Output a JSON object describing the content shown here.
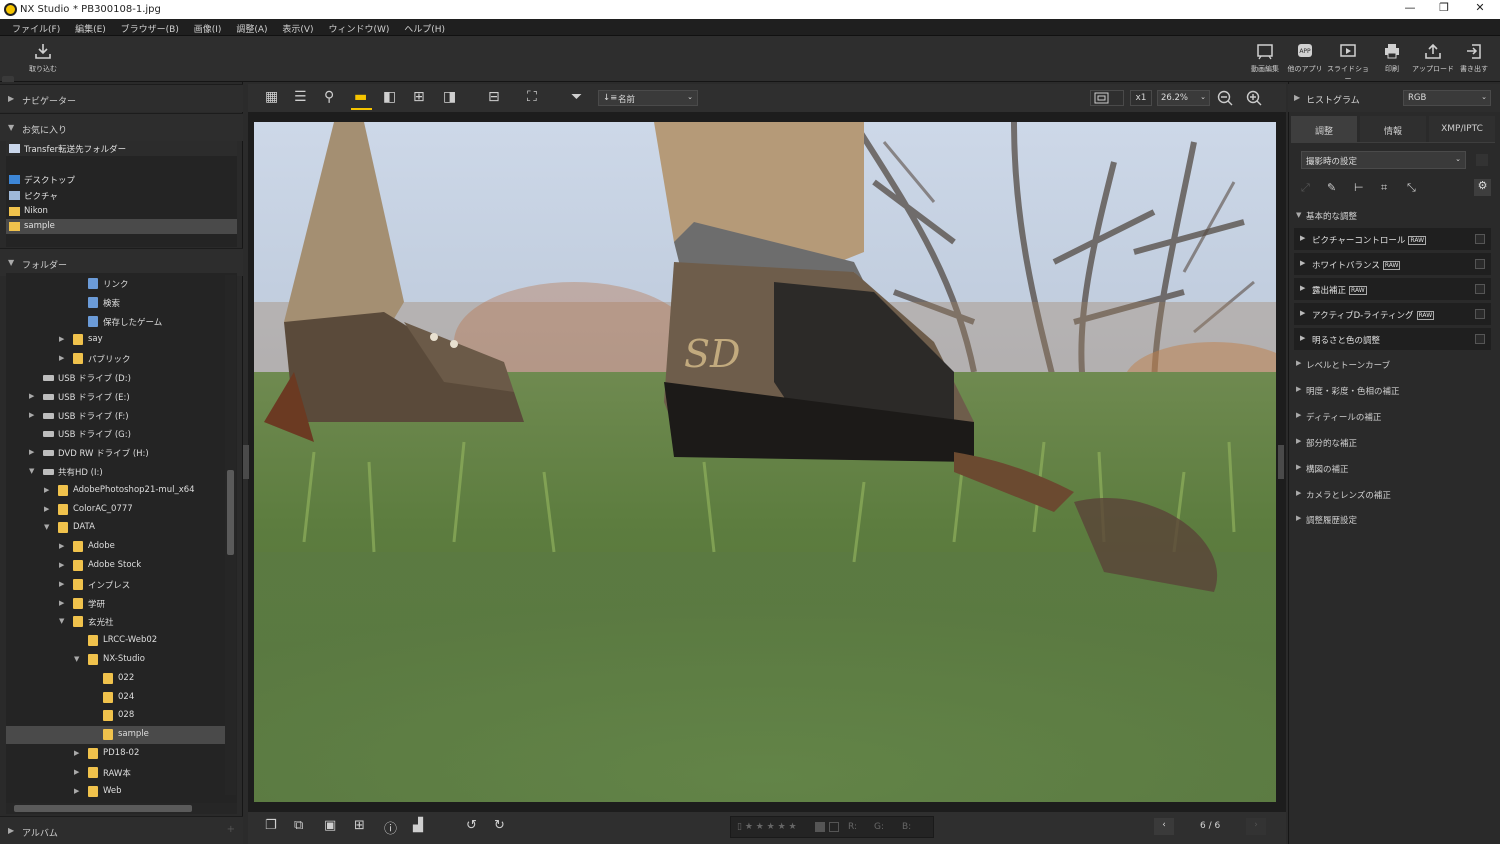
{
  "titlebar": {
    "app": "NX Studio",
    "doc": "* PB300108-1.jpg"
  },
  "menu": [
    "ファイル(F)",
    "編集(E)",
    "ブラウザー(B)",
    "画像(I)",
    "調整(A)",
    "表示(V)",
    "ウィンドウ(W)",
    "ヘルプ(H)"
  ],
  "toolbar": {
    "import": "取り込む",
    "right": [
      "動画編集",
      "他のアプリ",
      "スライドショー",
      "印刷",
      "アップロード",
      "書き出す"
    ]
  },
  "left": {
    "navigator": "ナビゲーター",
    "favorites": "お気に入り",
    "fav_items": [
      "Transfer転送先フォルダー",
      "デスクトップ",
      "ピクチャ",
      "Nikon",
      "sample"
    ],
    "folders": "フォルダー",
    "tree": [
      {
        "label": "リンク",
        "indent": 4,
        "type": "special",
        "arrow": ""
      },
      {
        "label": "検索",
        "indent": 4,
        "type": "special",
        "arrow": ""
      },
      {
        "label": "保存したゲーム",
        "indent": 4,
        "type": "special",
        "arrow": ""
      },
      {
        "label": "say",
        "indent": 3,
        "type": "folder",
        "arrow": "▶"
      },
      {
        "label": "パブリック",
        "indent": 3,
        "type": "folder",
        "arrow": "▶"
      },
      {
        "label": "USB ドライブ (D:)",
        "indent": 1,
        "type": "drive",
        "arrow": ""
      },
      {
        "label": "USB ドライブ (E:)",
        "indent": 1,
        "type": "drive",
        "arrow": "▶"
      },
      {
        "label": "USB ドライブ (F:)",
        "indent": 1,
        "type": "drive",
        "arrow": "▶"
      },
      {
        "label": "USB ドライブ (G:)",
        "indent": 1,
        "type": "drive",
        "arrow": ""
      },
      {
        "label": "DVD RW ドライブ (H:)",
        "indent": 1,
        "type": "drive",
        "arrow": "▶"
      },
      {
        "label": "共有HD (I:)",
        "indent": 1,
        "type": "drive",
        "arrow": "▼"
      },
      {
        "label": "AdobePhotoshop21-mul_x64",
        "indent": 2,
        "type": "folder",
        "arrow": "▶"
      },
      {
        "label": "ColorAC_0777",
        "indent": 2,
        "type": "folder",
        "arrow": "▶"
      },
      {
        "label": "DATA",
        "indent": 2,
        "type": "folder",
        "arrow": "▼"
      },
      {
        "label": "Adobe",
        "indent": 3,
        "type": "folder",
        "arrow": "▶"
      },
      {
        "label": "Adobe Stock",
        "indent": 3,
        "type": "folder",
        "arrow": "▶"
      },
      {
        "label": "インプレス",
        "indent": 3,
        "type": "folder",
        "arrow": "▶"
      },
      {
        "label": "学研",
        "indent": 3,
        "type": "folder",
        "arrow": "▶"
      },
      {
        "label": "玄光社",
        "indent": 3,
        "type": "folder",
        "arrow": "▼"
      },
      {
        "label": "LRCC-Web02",
        "indent": 4,
        "type": "folder",
        "arrow": ""
      },
      {
        "label": "NX-Studio",
        "indent": 4,
        "type": "folder",
        "arrow": "▼"
      },
      {
        "label": "022",
        "indent": 5,
        "type": "folder",
        "arrow": ""
      },
      {
        "label": "024",
        "indent": 5,
        "type": "folder",
        "arrow": ""
      },
      {
        "label": "028",
        "indent": 5,
        "type": "folder",
        "arrow": ""
      },
      {
        "label": "sample",
        "indent": 5,
        "type": "folder",
        "arrow": "",
        "selected": true
      },
      {
        "label": "PD18-02",
        "indent": 4,
        "type": "folder",
        "arrow": "▶"
      },
      {
        "label": "RAW本",
        "indent": 4,
        "type": "folder",
        "arrow": "▶"
      },
      {
        "label": "Web",
        "indent": 4,
        "type": "folder",
        "arrow": "▶"
      }
    ],
    "album": "アルバム"
  },
  "center": {
    "sort": "名前",
    "multiplier": "x1",
    "zoom": "26.2%",
    "counter": "6 / 6",
    "rgb_r": "R:",
    "rgb_g": "G:",
    "rgb_b": "B:"
  },
  "right": {
    "histogram": "ヒストグラム",
    "channel": "RGB",
    "tabs": [
      "調整",
      "情報",
      "XMP/IPTC"
    ],
    "preset": "撮影時の設定",
    "basic": "基本的な調整",
    "adjust_items": [
      {
        "label": "ピクチャーコントロール",
        "raw": true
      },
      {
        "label": "ホワイトバランス",
        "raw": true
      },
      {
        "label": "露出補正",
        "raw": true
      },
      {
        "label": "アクティブD-ライティング",
        "raw": true
      },
      {
        "label": "明るさと色の調整",
        "raw": false
      }
    ],
    "raw_badge": "RAW",
    "sections": [
      "レベルとトーンカーブ",
      "明度・彩度・色相の補正",
      "ディティールの補正",
      "部分的な補正",
      "構図の補正",
      "カメラとレンズの補正",
      "調整履歴設定"
    ]
  },
  "colors": {
    "accent": "#f5c400",
    "folder": "#f0c24c",
    "selected_row": "#4a4a4a"
  }
}
